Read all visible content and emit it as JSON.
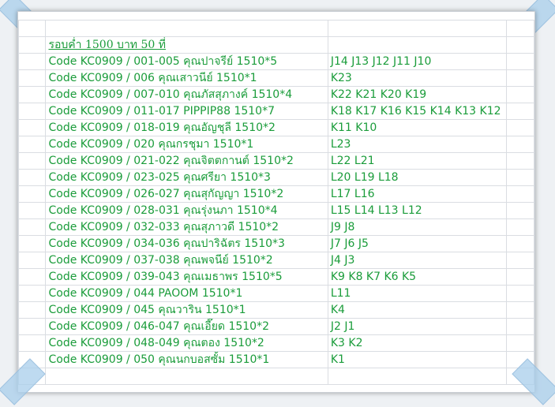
{
  "sheet": {
    "title": "รอบค่ำ 1500 บาท 50 ที่",
    "rows": [
      {
        "order": "Code KC0909 / 001-005 คุณปาจรีย์  1510*5",
        "seats": "J14 J13 J12 J11 J10"
      },
      {
        "order": "Code KC0909 / 006 คุณเสาวนีย์  1510*1",
        "seats": "K23"
      },
      {
        "order": "Code KC0909 / 007-010 คุณภัสสุภางค์  1510*4",
        "seats": "K22 K21 K20 K19"
      },
      {
        "order": "Code KC0909 / 011-017 PIPPIP88 1510*7",
        "seats": "K18 K17 K16 K15 K14 K13 K12"
      },
      {
        "order": "Code KC0909 / 018-019 คุณอัญชุลี  1510*2",
        "seats": "K11 K10"
      },
      {
        "order": "Code KC0909 / 020 คุณกรชุมา  1510*1",
        "seats": "L23"
      },
      {
        "order": "Code KC0909 / 021-022 คุณจิตตกานต์  1510*2",
        "seats": "L22 L21"
      },
      {
        "order": "Code KC0909 / 023-025 คุณศรียา  1510*3",
        "seats": "L20 L19 L18"
      },
      {
        "order": "Code KC0909 / 026-027 คุณสุกัญญา  1510*2",
        "seats": "L17 L16"
      },
      {
        "order": "Code KC0909 / 028-031 คุณรุ่งนภา  1510*4",
        "seats": "L15 L14 L13 L12"
      },
      {
        "order": "Code KC0909 / 032-033 คุณสุภาวดี  1510*2",
        "seats": "J9 J8"
      },
      {
        "order": "Code KC0909 / 034-036 คุณปาริฉัตร  1510*3",
        "seats": "J7 J6 J5"
      },
      {
        "order": "Code KC0909 / 037-038 คุณพจนีย์  1510*2",
        "seats": "J4 J3"
      },
      {
        "order": "Code KC0909 / 039-043 คุณเมธาพร  1510*5",
        "seats": "K9 K8 K7 K6 K5"
      },
      {
        "order": "Code KC0909 / 044 PAOOM 1510*1",
        "seats": "L11"
      },
      {
        "order": "Code KC0909 / 045 คุณวาริน  1510*1",
        "seats": "K4"
      },
      {
        "order": "Code KC0909 / 046-047 คุณเอี๊ยด  1510*2",
        "seats": "J2 J1"
      },
      {
        "order": "Code KC0909 / 048-049 คุณตอง  1510*2",
        "seats": "K3 K2"
      },
      {
        "order": "Code KC0909 / 050 คุณนกบอสซั้ม  1510*1",
        "seats": "K1"
      }
    ]
  },
  "colors": {
    "text": "#1a9c3a",
    "grid": "#dadde2",
    "tape": "#a8cdeb"
  }
}
